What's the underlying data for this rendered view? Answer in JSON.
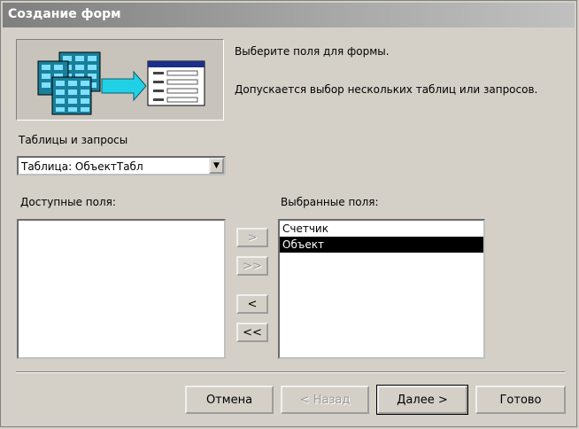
{
  "window": {
    "title": "Создание форм"
  },
  "intro": {
    "line1": "Выберите поля для формы.",
    "line2": "Допускается выбор нескольких таблиц или запросов."
  },
  "tables": {
    "label": "Таблицы и запросы",
    "selected": "Таблица: ОбъектТабл"
  },
  "available": {
    "label": "Доступные поля:",
    "items": []
  },
  "selected_fields": {
    "label": "Выбранные поля:",
    "items": [
      "Счетчик",
      "Объект"
    ],
    "selected_item": "Объект"
  },
  "move_buttons": {
    "add": ">",
    "add_all": ">>",
    "remove": "<",
    "remove_all": "<<"
  },
  "footer": {
    "cancel": "Отмена",
    "back": "< Назад",
    "next": "Далее >",
    "finish": "Готово"
  },
  "icons": {
    "wizard": "table-to-form-illustration",
    "dropdown": "chevron-down-icon"
  }
}
